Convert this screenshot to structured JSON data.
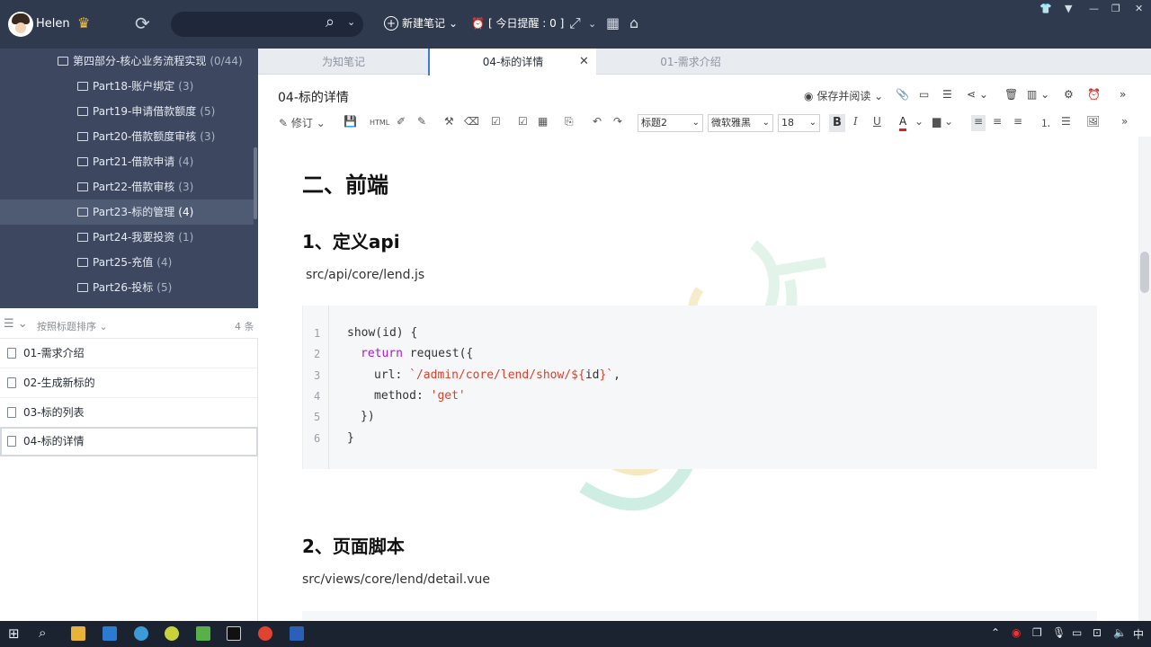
{
  "top": {
    "username": "Helen",
    "search_placeholder": "",
    "new_note": "新建笔记",
    "reminder": "[ 今日提醒 : 0 ]"
  },
  "tree": {
    "parent": {
      "label": "第四部分-核心业务流程实现",
      "count": "(0/44)"
    },
    "items": [
      {
        "label": "Part18-账户绑定",
        "count": "(3)"
      },
      {
        "label": "Part19-申请借款额度",
        "count": "(5)"
      },
      {
        "label": "Part20-借款额度审核",
        "count": "(3)"
      },
      {
        "label": "Part21-借款申请",
        "count": "(4)"
      },
      {
        "label": "Part22-借款审核",
        "count": "(3)"
      },
      {
        "label": "Part23-标的管理",
        "count": "(4)"
      },
      {
        "label": "Part24-我要投资",
        "count": "(1)"
      },
      {
        "label": "Part25-充值",
        "count": "(4)"
      },
      {
        "label": "Part26-投标",
        "count": "(5)"
      }
    ]
  },
  "list": {
    "sort_label": "按照标题排序",
    "count": "4 条",
    "notes": [
      "01-需求介绍",
      "02-生成新标的",
      "03-标的列表",
      "04-标的详情"
    ]
  },
  "tabs": [
    "为知笔记",
    "04-标的详情",
    "01-需求介绍"
  ],
  "doc": {
    "title": "04-标的详情",
    "save_read": "保存并阅读"
  },
  "format": {
    "revise": "修订",
    "heading": "标题2",
    "font": "微软雅黑",
    "size": "18",
    "bold": "B",
    "italic": "I",
    "underline": "U"
  },
  "content": {
    "h1": "二、前端",
    "h2a": "1、定义api",
    "path1": "src/api/core/lend.js",
    "code_lines": [
      {
        "n": "1",
        "text": "show(id) {"
      },
      {
        "n": "2",
        "kw": "return",
        "text": " request({"
      },
      {
        "n": "3",
        "pre": "url: ",
        "str": "`/admin/core/lend/show/${",
        "mid": "id",
        "str2": "}`",
        "post": ","
      },
      {
        "n": "4",
        "pre": "method: ",
        "str": "'get'"
      },
      {
        "n": "5",
        "text": "})"
      },
      {
        "n": "6",
        "text": "}"
      }
    ],
    "h2b": "2、页面脚本",
    "path2": "src/views/core/lend/detail.vue"
  },
  "colors": {
    "topbar": "#2f3a4f",
    "sidebar": "#3d4860",
    "accent": "#3d7be0"
  }
}
